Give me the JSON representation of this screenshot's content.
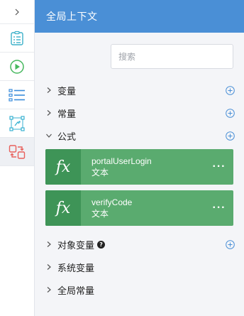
{
  "rail": {
    "toggle_icon": "chevron-right-icon",
    "items": [
      {
        "name": "rail-document",
        "icon": "document-list-icon",
        "color": "#3bb0c9"
      },
      {
        "name": "rail-play",
        "icon": "play-icon",
        "color": "#46b85e"
      },
      {
        "name": "rail-list",
        "icon": "bulleted-list-icon",
        "color": "#3b8ddb"
      },
      {
        "name": "rail-node-map",
        "icon": "node-map-icon",
        "color": "#38b2d1"
      },
      {
        "name": "rail-context",
        "icon": "context-switch-icon",
        "color": "#e8605c"
      }
    ]
  },
  "panel": {
    "title": "全局上下文",
    "search_placeholder": "搜索",
    "header_color": "#4a8fd6"
  },
  "tree": {
    "variables": {
      "label": "变量",
      "expanded": false
    },
    "constants": {
      "label": "常量",
      "expanded": false
    },
    "formulas": {
      "label": "公式",
      "expanded": true
    },
    "object_variables": {
      "label": "对象变量",
      "expanded": false
    },
    "system_variables": {
      "label": "系统变量",
      "expanded": false
    },
    "global_constants": {
      "label": "全局常量",
      "expanded": false
    }
  },
  "formula_cards": [
    {
      "icon_text": "fx",
      "name": "portalUserLogin",
      "type": "文本",
      "more": "···"
    },
    {
      "icon_text": "fx",
      "name": "verifyCode",
      "type": "文本",
      "more": "···"
    }
  ],
  "colors": {
    "card": "#5aab6f",
    "card_icon_bg": "#3e9457",
    "plus": "#4a8fd6"
  }
}
